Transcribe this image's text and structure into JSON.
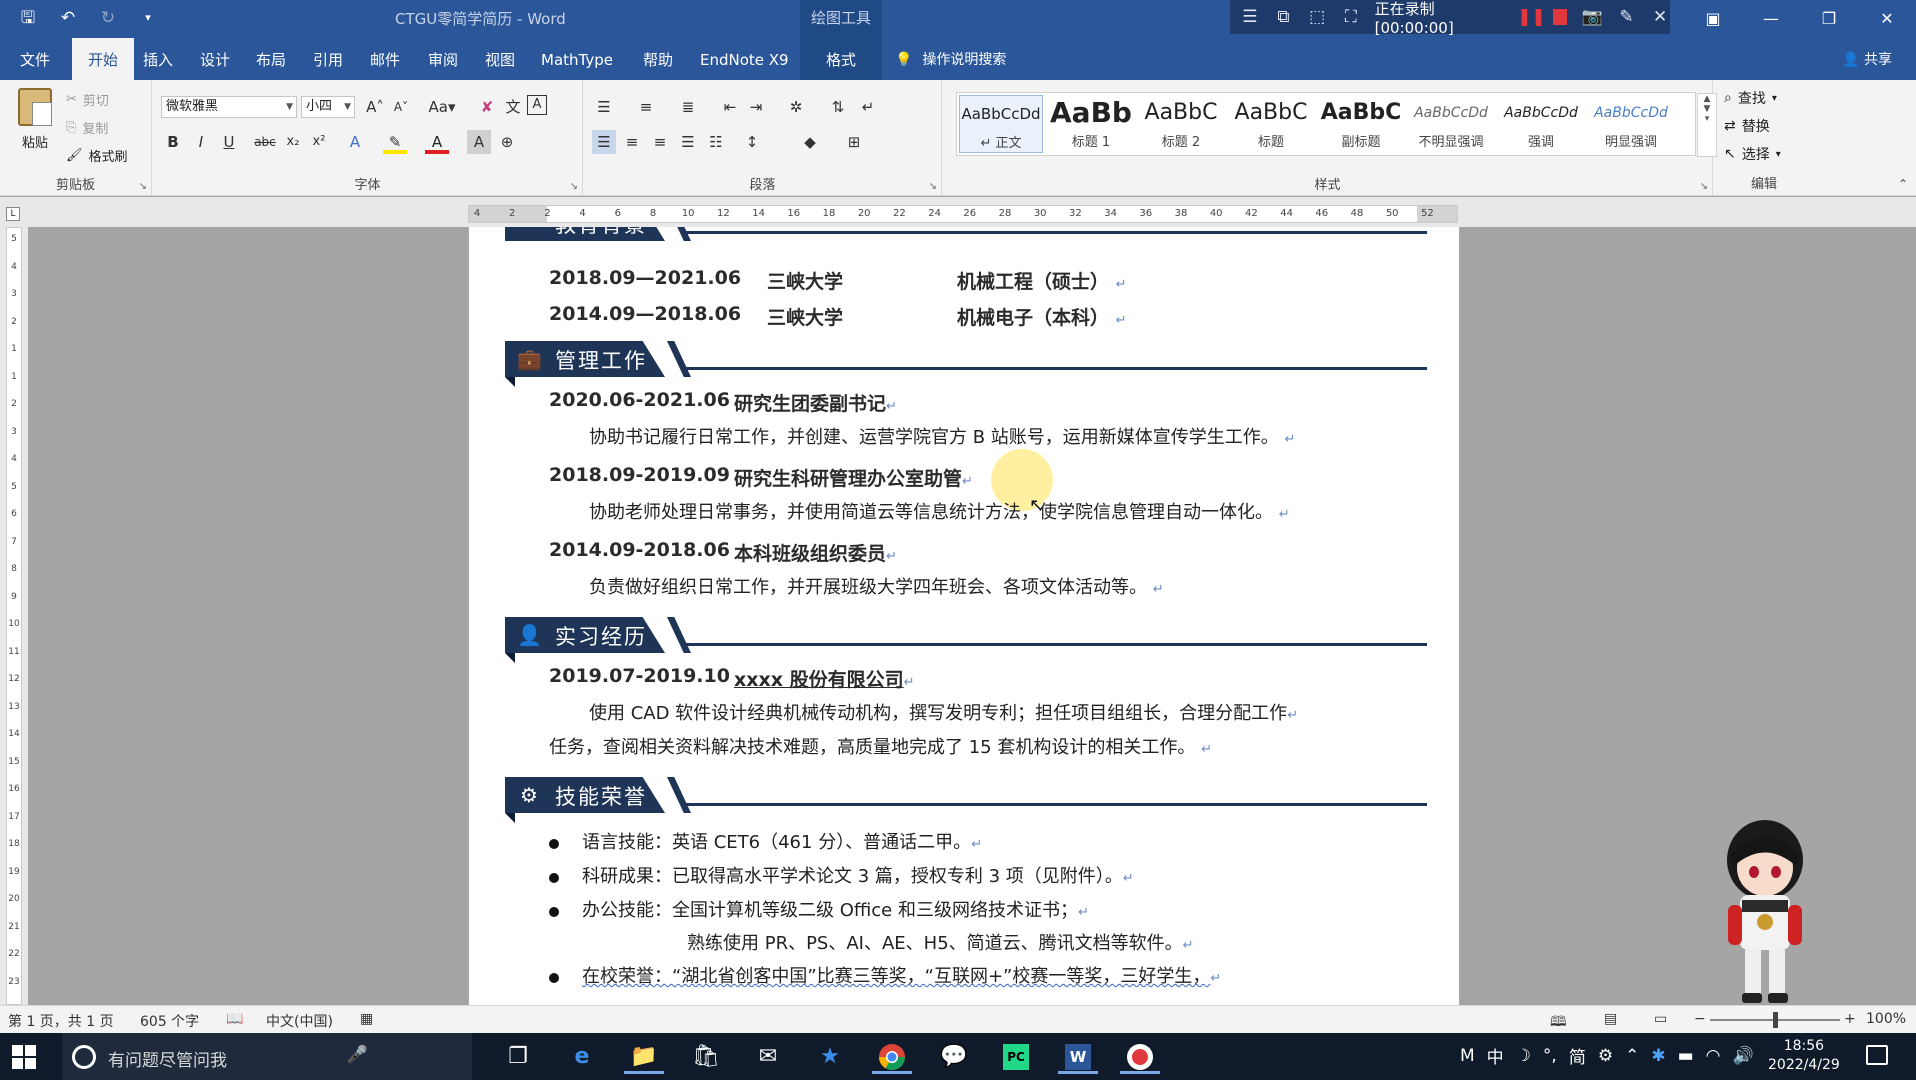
{
  "titlebar": {
    "doc_title": "CTGU零简学简历 - Word",
    "context_header": "绘图工具",
    "recording_text": "正在录制 [00:00:00]"
  },
  "tabs": [
    "文件",
    "开始",
    "插入",
    "设计",
    "布局",
    "引用",
    "邮件",
    "审阅",
    "视图",
    "MathType",
    "帮助",
    "EndNote X9",
    "格式"
  ],
  "active_tab": "开始",
  "tell_me": "操作说明搜索",
  "share": "共享",
  "ribbon": {
    "clipboard": {
      "paste": "粘贴",
      "cut": "剪切",
      "copy": "复制",
      "format_painter": "格式刷",
      "label": "剪贴板"
    },
    "font": {
      "name": "微软雅黑",
      "size": "小四",
      "label": "字体"
    },
    "paragraph_label": "段落",
    "styles_label": "样式",
    "styles": [
      {
        "sample": "AaBbCcDd",
        "name": "↵ 正文"
      },
      {
        "sample": "AaBb",
        "name": "标题 1"
      },
      {
        "sample": "AaBbC",
        "name": "标题 2"
      },
      {
        "sample": "AaBbC",
        "name": "标题"
      },
      {
        "sample": "AaBbC",
        "name": "副标题"
      },
      {
        "sample": "AaBbCcDd",
        "name": "不明显强调"
      },
      {
        "sample": "AaBbCcDd",
        "name": "强调"
      },
      {
        "sample": "AaBbCcDd",
        "name": "明显强调"
      }
    ],
    "editing": {
      "find": "查找",
      "replace": "替换",
      "select": "选择",
      "label": "编辑"
    }
  },
  "ruler": {
    "h_labels": [
      "4",
      "2",
      "2",
      "4",
      "6",
      "8",
      "10",
      "12",
      "14",
      "16",
      "18",
      "20",
      "22",
      "24",
      "26",
      "28",
      "30",
      "32",
      "34",
      "36",
      "38",
      "40",
      "42",
      "44",
      "46",
      "48",
      "50",
      "52"
    ],
    "v_labels": [
      "5",
      "4",
      "3",
      "2",
      "1",
      "1",
      "2",
      "3",
      "4",
      "5",
      "6",
      "7",
      "8",
      "9",
      "10",
      "11",
      "12",
      "13",
      "14",
      "15",
      "16",
      "17",
      "18",
      "19",
      "20",
      "21",
      "22",
      "23"
    ]
  },
  "document": {
    "education_partial_title": "教育背景",
    "education": [
      {
        "date": "2018.09—2021.06",
        "school": "三峡大学",
        "major": "机械工程（硕士）"
      },
      {
        "date": "2014.09—2018.06",
        "school": "三峡大学",
        "major": "机械电子（本科）"
      }
    ],
    "mgmt_title": "管理工作",
    "mgmt": [
      {
        "date": "2020.06-2021.06",
        "role": "研究生团委副书记",
        "desc": "协助书记履行日常工作，并创建、运营学院官方 B 站账号，运用新媒体宣传学生工作。"
      },
      {
        "date": "2018.09-2019.09",
        "role": "研究生科研管理办公室助管",
        "desc": "协助老师处理日常事务，并使用简道云等信息统计方法，使学院信息管理自动一体化。"
      },
      {
        "date": "2014.09-2018.06",
        "role": "本科班级组织委员",
        "desc": "负责做好组织日常工作，并开展班级大学四年班会、各项文体活动等。"
      }
    ],
    "intern_title": "实习经历",
    "intern": {
      "date": "2019.07-2019.10",
      "company": "xxxx 股份有限公司",
      "desc1": "使用 CAD 软件设计经典机械传动机构，撰写发明专利；担任项目组组长，合理分配工作",
      "desc2": "任务，查阅相关资料解决技术难题，高质量地完成了 15 套机构设计的相关工作。"
    },
    "skills_title": "技能荣誉",
    "skills": [
      "语言技能：英语 CET6（461 分）、普通话二甲。",
      "科研成果：已取得高水平学术论文 3 篇，授权专利 3 项（见附件）。",
      "办公技能：全国计算机等级二级 Office 和三级网络技术证书；",
      "在校荣誉：“湖北省创客中国”比赛三等奖，“互联网+”校赛一等奖，三好学生，"
    ],
    "skills_cont": "熟练使用 PR、PS、AI、AE、H5、简道云、腾讯文档等软件。",
    "pm": "↵"
  },
  "status": {
    "page": "第 1 页，共 1 页",
    "words": "605 个字",
    "lang": "中文(中国)",
    "zoom": "100%"
  },
  "taskbar": {
    "search_placeholder": "有问题尽管问我",
    "time": "18:56",
    "date": "2022/4/29",
    "ime": "中",
    "ime2": "简"
  },
  "colors": {
    "word_blue": "#2b579a",
    "section_navy": "#1f3558",
    "taskbar": "#0f1b2b"
  }
}
